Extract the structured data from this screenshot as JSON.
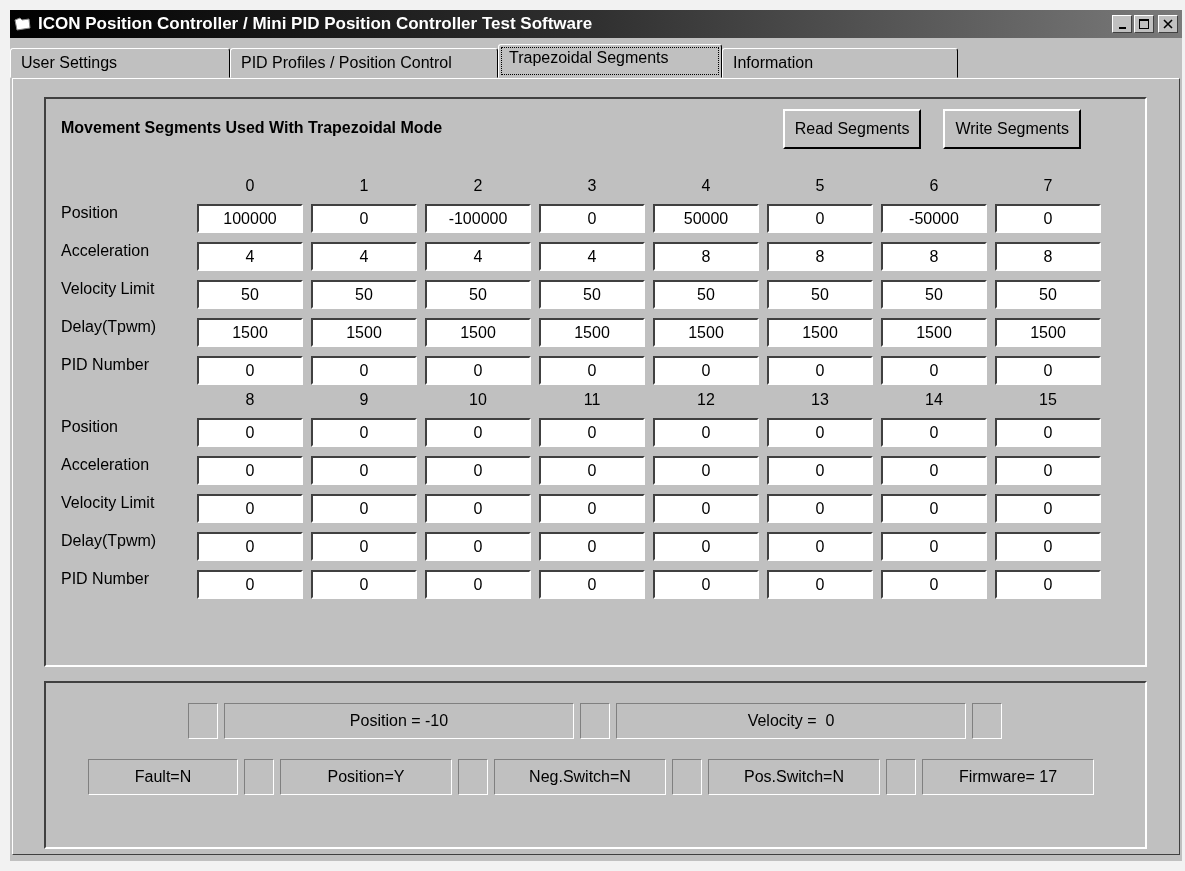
{
  "window": {
    "title": "ICON Position Controller / Mini PID Position Controller Test Software"
  },
  "tabs": [
    {
      "label": "User Settings",
      "selected": false
    },
    {
      "label": "PID Profiles / Position Control",
      "selected": false
    },
    {
      "label": "Trapezoidal Segments",
      "selected": true
    },
    {
      "label": "Information",
      "selected": false
    }
  ],
  "segments_panel": {
    "title": "Movement Segments Used With Trapezoidal Mode",
    "buttons": [
      "Read Segments",
      "Write Segments"
    ],
    "groups": [
      {
        "columns": [
          "0",
          "1",
          "2",
          "3",
          "4",
          "5",
          "6",
          "7"
        ],
        "rows": [
          {
            "label": "Position",
            "values": [
              "100000",
              "0",
              "-100000",
              "0",
              "50000",
              "0",
              "-50000",
              "0"
            ]
          },
          {
            "label": "Acceleration",
            "values": [
              "4",
              "4",
              "4",
              "4",
              "8",
              "8",
              "8",
              "8"
            ]
          },
          {
            "label": "Velocity Limit",
            "values": [
              "50",
              "50",
              "50",
              "50",
              "50",
              "50",
              "50",
              "50"
            ]
          },
          {
            "label": "Delay(Tpwm)",
            "values": [
              "1500",
              "1500",
              "1500",
              "1500",
              "1500",
              "1500",
              "1500",
              "1500"
            ]
          },
          {
            "label": "PID Number",
            "values": [
              "0",
              "0",
              "0",
              "0",
              "0",
              "0",
              "0",
              "0"
            ]
          }
        ]
      },
      {
        "columns": [
          "8",
          "9",
          "10",
          "11",
          "12",
          "13",
          "14",
          "15"
        ],
        "rows": [
          {
            "label": "Position",
            "values": [
              "0",
              "0",
              "0",
              "0",
              "0",
              "0",
              "0",
              "0"
            ]
          },
          {
            "label": "Acceleration",
            "values": [
              "0",
              "0",
              "0",
              "0",
              "0",
              "0",
              "0",
              "0"
            ]
          },
          {
            "label": "Velocity Limit",
            "values": [
              "0",
              "0",
              "0",
              "0",
              "0",
              "0",
              "0",
              "0"
            ]
          },
          {
            "label": "Delay(Tpwm)",
            "values": [
              "0",
              "0",
              "0",
              "0",
              "0",
              "0",
              "0",
              "0"
            ]
          },
          {
            "label": "PID Number",
            "values": [
              "0",
              "0",
              "0",
              "0",
              "0",
              "0",
              "0",
              "0"
            ]
          }
        ]
      }
    ]
  },
  "status": {
    "motion": [
      "Position = -10",
      "Velocity =  0"
    ],
    "flags": [
      "Fault=N",
      "Position=Y",
      "Neg.Switch=N",
      "Pos.Switch=N",
      "Firmware= 17"
    ]
  }
}
